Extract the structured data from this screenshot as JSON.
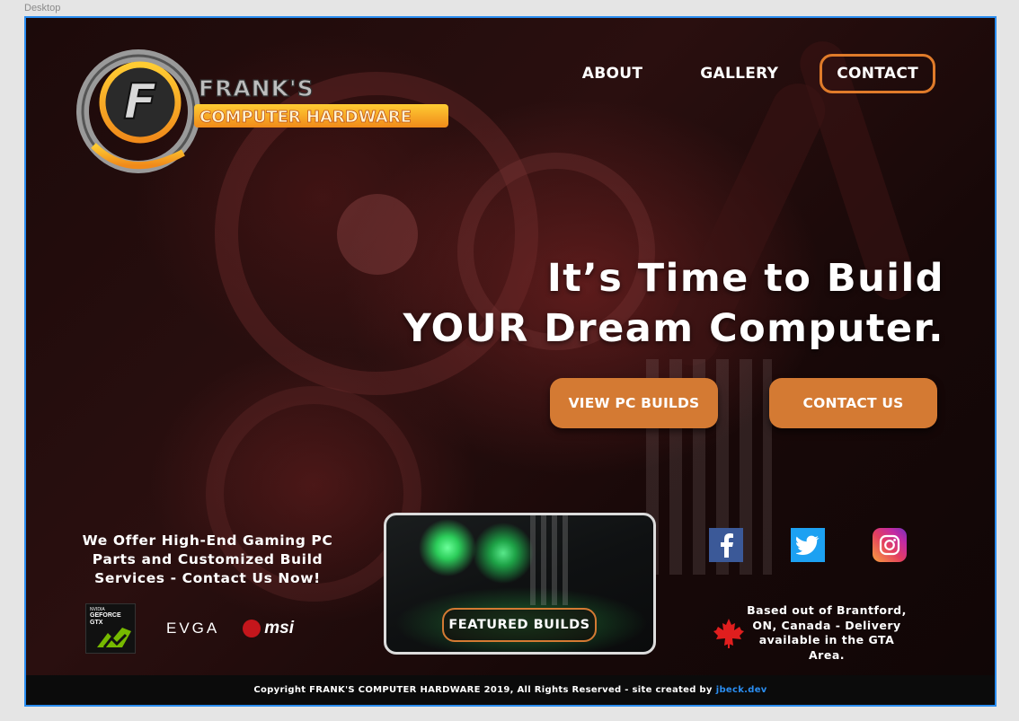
{
  "canvas": {
    "frame_label": "Desktop"
  },
  "brand": {
    "logo_letter": "F",
    "logo_line1": "FRANK'S",
    "logo_line2": "COMPUTER HARDWARE"
  },
  "nav": {
    "items": [
      {
        "label": "ABOUT"
      },
      {
        "label": "GALLERY"
      },
      {
        "label": "CONTACT"
      }
    ]
  },
  "hero": {
    "line1": "It’s Time to Build",
    "line2": "YOUR Dream Computer.",
    "primary_button": "VIEW PC BUILDS",
    "secondary_button": "CONTACT US"
  },
  "offer": {
    "text": "We Offer High-End Gaming PC Parts and Customized Build Services - Contact Us Now!"
  },
  "partners": {
    "nvidia_top": "NVIDIA",
    "nvidia_main": "GEFORCE",
    "nvidia_sub": "GTX",
    "evga": "EVGA",
    "msi": "msi"
  },
  "featured": {
    "button": "FEATURED BUILDS"
  },
  "social": [
    {
      "icon": "facebook-icon",
      "color": "#3b5998"
    },
    {
      "icon": "twitter-icon",
      "color": "#1da1f2"
    },
    {
      "icon": "instagram-icon",
      "color": "#e4405f"
    }
  ],
  "location": {
    "text": "Based out of Brantford, ON, Canada - Delivery available in the GTA Area."
  },
  "footer": {
    "text": "Copyright FRANK'S COMPUTER HARDWARE 2019, All Rights Reserved - site created by",
    "credit": "jbeck.dev"
  },
  "colors": {
    "accent": "#d47a33",
    "selection": "#2a8df0",
    "footer_bg": "#0b0b0b"
  }
}
